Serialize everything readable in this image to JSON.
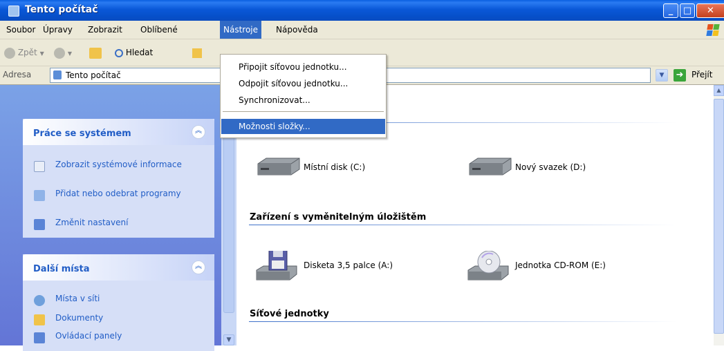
{
  "window": {
    "title": "Tento počítač",
    "buttons": [
      "minimize",
      "maximize",
      "close"
    ]
  },
  "menubar": {
    "items": [
      "Soubor",
      "Úpravy",
      "Zobrazit",
      "Oblíbené",
      "Nástroje",
      "Nápověda"
    ],
    "active": "Nástroje"
  },
  "toolbar": {
    "back_label": "Zpět",
    "search_label": "Hledat"
  },
  "address": {
    "label": "Adresa",
    "value": "Tento počítač",
    "go_label": "Přejít"
  },
  "tools_menu": {
    "items": [
      "Připojit síťovou jednotku...",
      "Odpojit síťovou jednotku...",
      "Synchronizovat...",
      "Možnosti složky..."
    ],
    "highlighted": "Možnosti složky..."
  },
  "sidebar": {
    "system_tasks": {
      "title": "Práce se systémem",
      "items": [
        "Zobrazit systémové informace",
        "Přidat nebo odebrat programy",
        "Změnit nastavení"
      ]
    },
    "other_places": {
      "title": "Další místa",
      "items": [
        "Místa v síti",
        "Dokumenty",
        "Ovládací panely"
      ]
    }
  },
  "main": {
    "hard_disks": [
      {
        "label": "Místní disk (C:)",
        "icon": "hard-disk-icon"
      },
      {
        "label": "Nový svazek (D:)",
        "icon": "hard-disk-icon"
      }
    ],
    "removable_title": "Zařízení s vyměnitelným úložištěm",
    "removable": [
      {
        "label": "Disketa 3,5 palce (A:)",
        "icon": "floppy-drive-icon"
      },
      {
        "label": "Jednotka CD-ROM (E:)",
        "icon": "cd-drive-icon"
      }
    ],
    "network_title": "Síťové jednotky"
  },
  "colors": {
    "title_bar": "#0a58d8",
    "menu_highlight": "#316ac5",
    "sidebar_link": "#215dc6",
    "chrome": "#ece9d8"
  }
}
